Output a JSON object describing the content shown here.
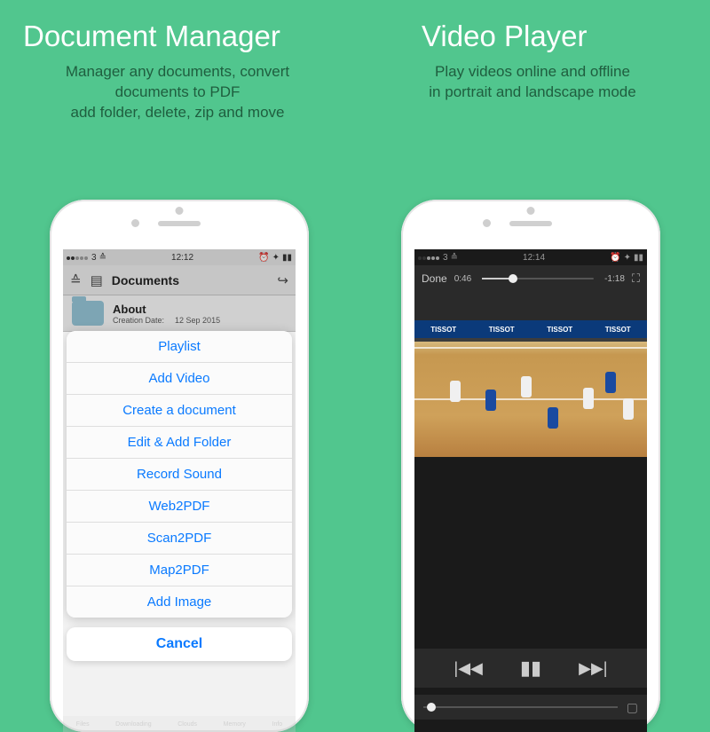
{
  "left": {
    "title": "Document Manager",
    "subtitle_line1": "Manager any documents, convert",
    "subtitle_line2": "documents to PDF",
    "subtitle_line3": "add folder, delete, zip and move",
    "statusbar": {
      "carrier": "3",
      "time": "12:12"
    },
    "nav_title": "Documents",
    "folder": {
      "name": "About",
      "meta_label": "Creation Date:",
      "meta_date": "12 Sep 2015"
    },
    "actions": [
      "Playlist",
      "Add Video",
      "Create a document",
      "Edit & Add Folder",
      "Record Sound",
      "Web2PDF",
      "Scan2PDF",
      "Map2PDF",
      "Add Image"
    ],
    "cancel": "Cancel",
    "tabs": [
      "Files",
      "Downloading",
      "Clouds",
      "Memory",
      "Info"
    ]
  },
  "right": {
    "title": "Video Player",
    "subtitle_line1": "Play videos online and offline",
    "subtitle_line2": "in portrait and landscape mode",
    "statusbar": {
      "carrier": "3",
      "time": "12:14"
    },
    "done": "Done",
    "elapsed": "0:46",
    "remaining": "-1:18",
    "ads": [
      "TISSOT",
      "TISSOT",
      "TISSOT",
      "TISSOT"
    ]
  }
}
